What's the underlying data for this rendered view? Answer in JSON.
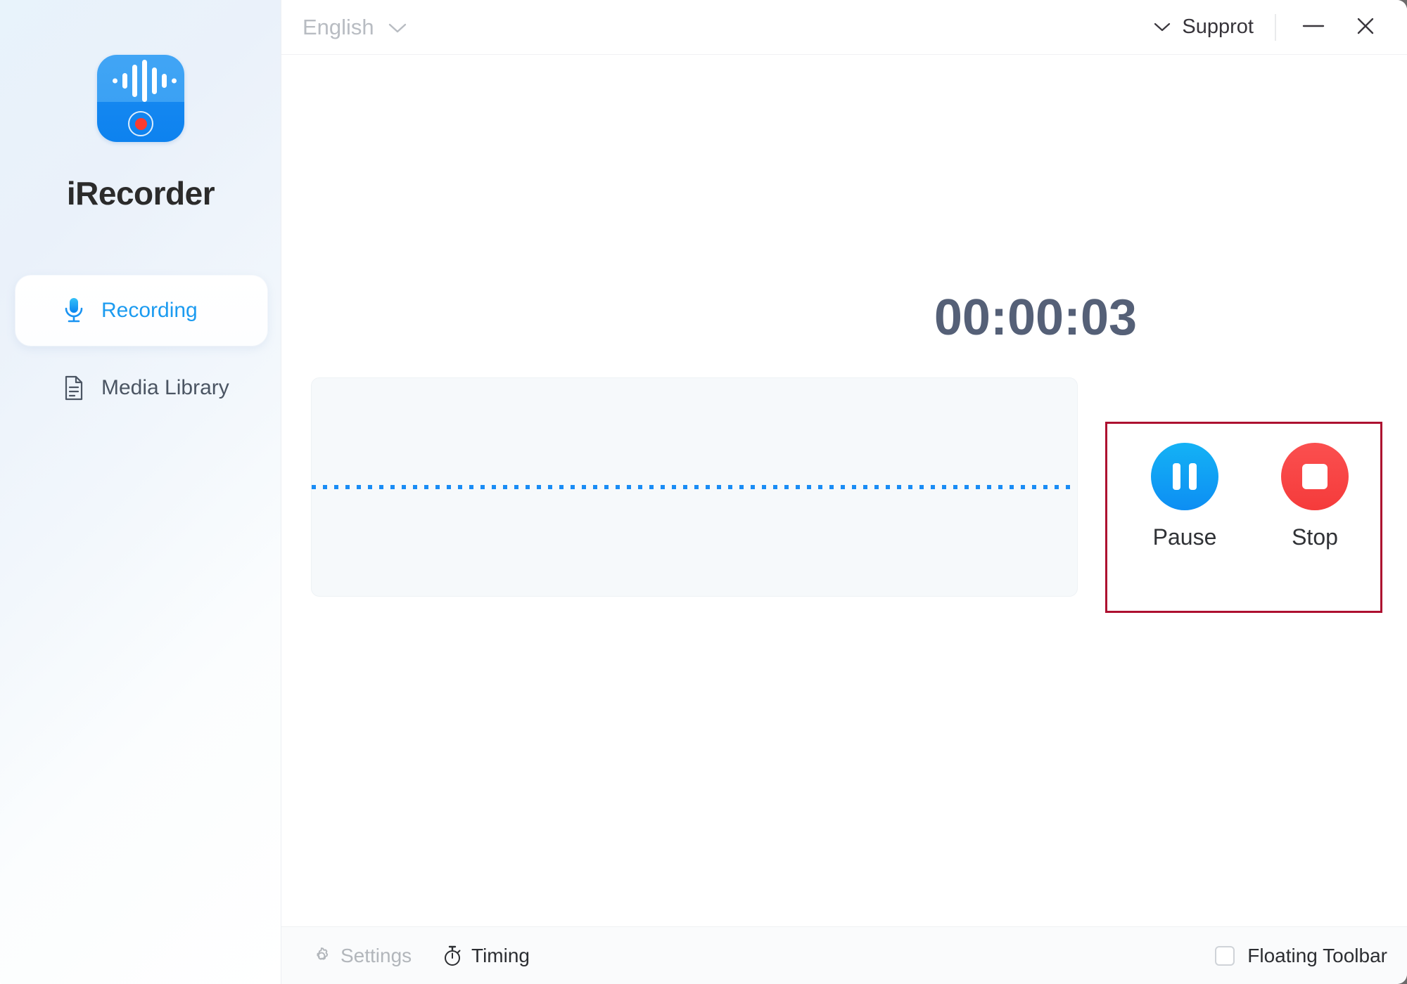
{
  "window": {
    "minimize_icon": "minimize-icon",
    "close_icon": "close-icon"
  },
  "sidebar": {
    "logo_icon": "app-logo-icon",
    "app_title": "iRecorder",
    "items": [
      {
        "label": "Recording",
        "icon": "microphone-icon",
        "active": true
      },
      {
        "label": "Media Library",
        "icon": "document-icon",
        "active": false
      }
    ]
  },
  "header": {
    "language": "English",
    "language_chevron_icon": "chevron-down-icon",
    "support_label": "Supprot",
    "support_chevron_icon": "chevron-down-icon"
  },
  "main": {
    "timer": "00:00:03",
    "waveform_name": "waveform-display",
    "controls": [
      {
        "label": "Pause",
        "icon": "pause-icon",
        "color": "#0d8ef3"
      },
      {
        "label": "Stop",
        "icon": "stop-icon",
        "color": "#f53b3b"
      }
    ],
    "annotation_color": "#ad1030"
  },
  "footer": {
    "settings_label": "Settings",
    "settings_icon": "gear-icon",
    "timing_label": "Timing",
    "timing_icon": "stopwatch-icon",
    "floating_toolbar_label": "Floating Toolbar",
    "floating_toolbar_checked": false
  }
}
